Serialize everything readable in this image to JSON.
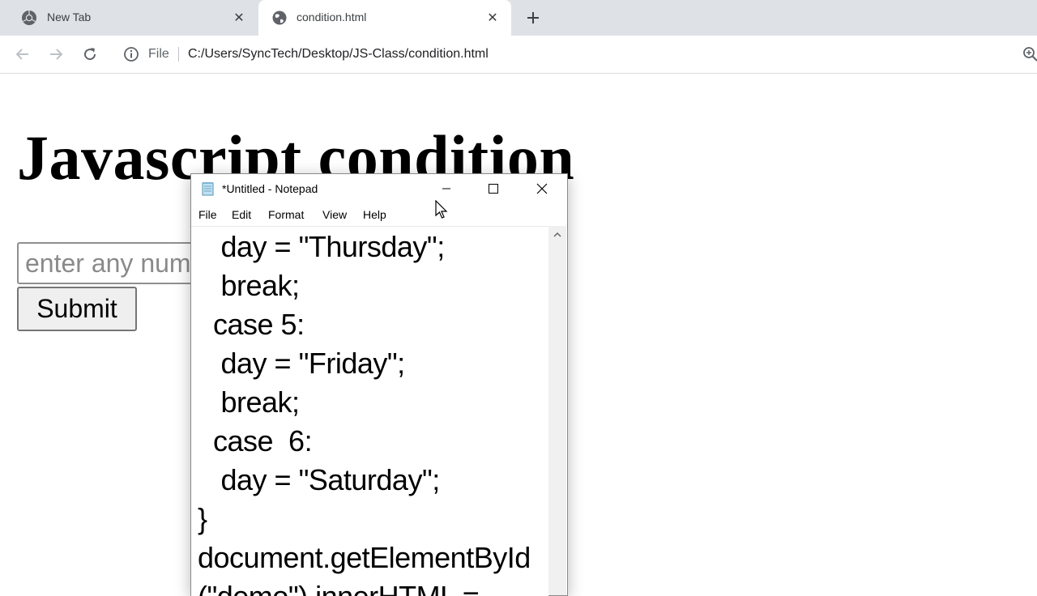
{
  "browser": {
    "tabs": [
      {
        "title": "New Tab",
        "icon": "chrome-icon",
        "active": false
      },
      {
        "title": "condition.html",
        "icon": "globe-icon",
        "active": true
      }
    ],
    "new_tab_symbol": "+",
    "close_symbol": "✕",
    "omnibox": {
      "scheme": "File",
      "url": "C:/Users/SyncTech/Desktop/JS-Class/condition.html"
    }
  },
  "page": {
    "heading": "Javascript condition",
    "input_placeholder": "enter any number",
    "input_value": "",
    "submit_label": "Submit"
  },
  "notepad": {
    "title": "*Untitled - Notepad",
    "menu": [
      "File",
      "Edit",
      "Format",
      "View",
      "Help"
    ],
    "code_lines": [
      "   day = \"Thursday\";",
      "   break;",
      "  case 5:",
      "   day = \"Friday\";",
      "   break;",
      "  case  6:",
      "   day = \"Saturday\";",
      "}",
      "document.getElementById",
      "(\"demo\").innerHTML ="
    ]
  },
  "colors": {
    "tabstrip": "#dee1e6",
    "active_tab": "#ffffff",
    "text": "#202124",
    "notepad_border": "#8a8a8a"
  }
}
